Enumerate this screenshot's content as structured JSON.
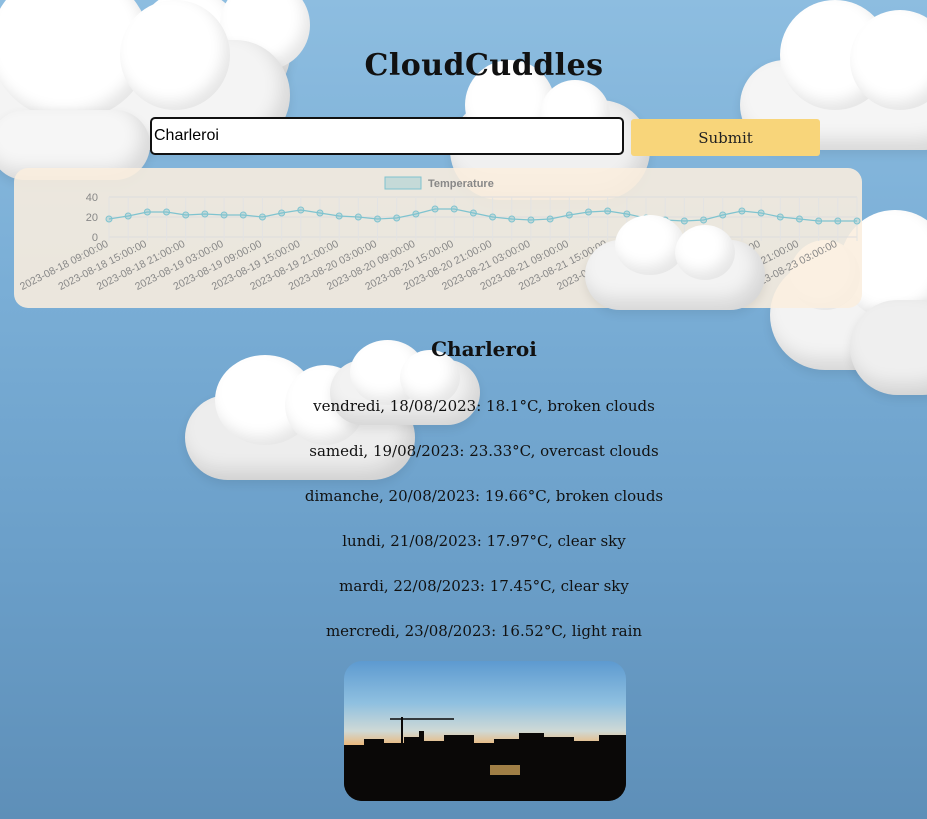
{
  "app": {
    "title": "CloudCuddles"
  },
  "search": {
    "value": "Charleroi",
    "submit_label": "Submit"
  },
  "chart_data": {
    "type": "line",
    "legend": "Temperature",
    "legend_position": "top",
    "ylim": [
      0,
      40
    ],
    "yticks": [
      "40",
      "20",
      "0"
    ],
    "grid": true,
    "color": "#7fc3cf",
    "x": [
      "2023-08-18 09:00:00",
      "2023-08-18 12:00:00",
      "2023-08-18 15:00:00",
      "2023-08-18 18:00:00",
      "2023-08-18 21:00:00",
      "2023-08-19 00:00:00",
      "2023-08-19 03:00:00",
      "2023-08-19 06:00:00",
      "2023-08-19 09:00:00",
      "2023-08-19 12:00:00",
      "2023-08-19 15:00:00",
      "2023-08-19 18:00:00",
      "2023-08-19 21:00:00",
      "2023-08-20 00:00:00",
      "2023-08-20 03:00:00",
      "2023-08-20 06:00:00",
      "2023-08-20 09:00:00",
      "2023-08-20 12:00:00",
      "2023-08-20 15:00:00",
      "2023-08-20 18:00:00",
      "2023-08-20 21:00:00",
      "2023-08-21 00:00:00",
      "2023-08-21 03:00:00",
      "2023-08-21 06:00:00",
      "2023-08-21 09:00:00",
      "2023-08-21 12:00:00",
      "2023-08-21 15:00:00",
      "2023-08-21 18:00:00",
      "2023-08-21 21:00:00",
      "2023-08-22 00:00:00",
      "2023-08-22 03:00:00",
      "2023-08-22 06:00:00",
      "2023-08-22 09:00:00",
      "2023-08-22 12:00:00",
      "2023-08-22 15:00:00",
      "2023-08-22 18:00:00",
      "2023-08-22 21:00:00",
      "2023-08-23 00:00:00",
      "2023-08-23 03:00:00",
      "2023-08-23 06:00:00"
    ],
    "xtick_labels": [
      "2023-08-18 09:00:00",
      "2023-08-18 15:00:00",
      "2023-08-18 21:00:00",
      "2023-08-19 03:00:00",
      "2023-08-19 09:00:00",
      "2023-08-19 15:00:00",
      "2023-08-19 21:00:00",
      "2023-08-20 03:00:00",
      "2023-08-20 09:00:00",
      "2023-08-20 15:00:00",
      "2023-08-20 21:00:00",
      "2023-08-21 03:00:00",
      "2023-08-21 09:00:00",
      "2023-08-21 15:00:00",
      "2023-08-21 21:00:00",
      "2023-08-22 03:00:00",
      "2023-08-22 09:00:00",
      "2023-08-22 15:00:00",
      "2023-08-22 21:00:00",
      "2023-08-23 03:00:00"
    ],
    "values": [
      18,
      21,
      25,
      25,
      22,
      23,
      22,
      22,
      20,
      24,
      27,
      24,
      21,
      20,
      18,
      19,
      23,
      28,
      28,
      24,
      20,
      18,
      17,
      18,
      22,
      25,
      26,
      23,
      19,
      17,
      16,
      17,
      22,
      26,
      24,
      20,
      18,
      16,
      16,
      16
    ]
  },
  "forecast": {
    "city": "Charleroi",
    "days": [
      "vendredi, 18/08/2023: 18.1°C, broken clouds",
      "samedi, 19/08/2023: 23.33°C, overcast clouds",
      "dimanche, 20/08/2023: 19.66°C, broken clouds",
      "lundi, 21/08/2023: 17.97°C, clear sky",
      "mardi, 22/08/2023: 17.45°C, clear sky",
      "mercredi, 23/08/2023: 16.52°C, light rain"
    ]
  }
}
